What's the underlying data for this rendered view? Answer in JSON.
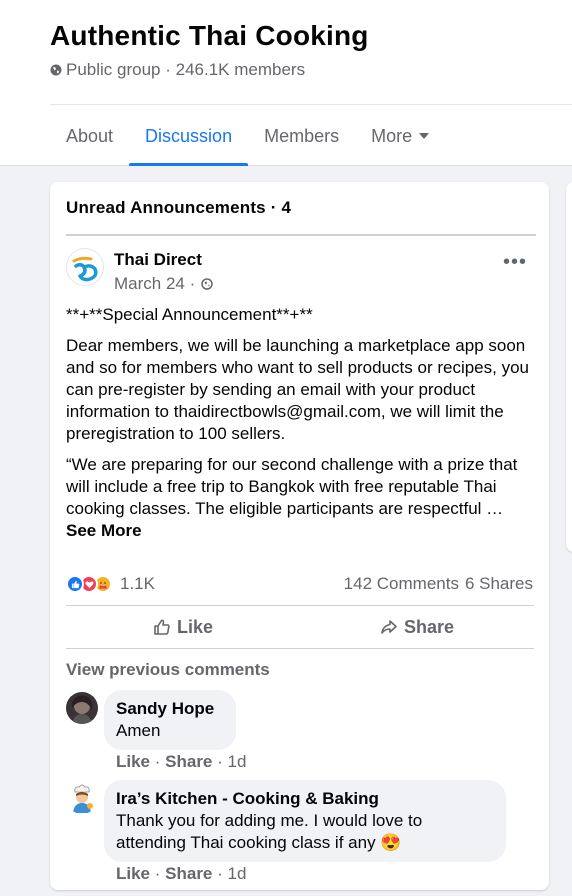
{
  "group": {
    "name": "Authentic Thai Cooking",
    "meta": "Public group · 246.1K members"
  },
  "tabs": [
    {
      "label": "About"
    },
    {
      "label": "Discussion"
    },
    {
      "label": "Members"
    },
    {
      "label": "More"
    }
  ],
  "announcements": {
    "header": "Unread Announcements · 4"
  },
  "post": {
    "author": "Thai Direct",
    "date": "March 24 ·",
    "title_line": "**+**Special Announcement**+**",
    "paragraph1": "Dear members, we will be launching a marketplace app soon and so for members who want to sell products or recipes, you can pre-register by sending an email with your product information to thaidirectbowls@gmail.com, we will limit the preregistration to 100 sellers.",
    "paragraph2": "“We are preparing for our second challenge with a prize that will include a free trip to Bangkok with free reputable Thai cooking classes. The eligible participants are respectful … ",
    "see_more": "See More",
    "reaction_count": "1.1K",
    "comments_count": "142 Comments",
    "shares_count": "6 Shares",
    "like_label": "Like",
    "share_label": "Share"
  },
  "comments": {
    "view_previous": "View previous comments",
    "items": [
      {
        "name": "Sandy Hope",
        "text": "Amen",
        "like": "Like",
        "share": "Share",
        "time": "1d"
      },
      {
        "name": "Ira’s Kitchen - Cooking & Baking",
        "text": "Thank you for adding me. I would love to attending Thai cooking class if any",
        "emoji": "😍",
        "like": "Like",
        "share": "Share",
        "time": "1d"
      }
    ]
  },
  "colors": {
    "accent": "#1877f2",
    "secondary_text": "#65676b",
    "background": "#f0f2f5"
  },
  "icons": [
    "globe-icon",
    "more-options-icon",
    "like-reaction-icon",
    "love-reaction-icon",
    "care-reaction-icon",
    "thumbs-up-icon",
    "share-arrow-icon",
    "heart-eyes-emoji"
  ]
}
